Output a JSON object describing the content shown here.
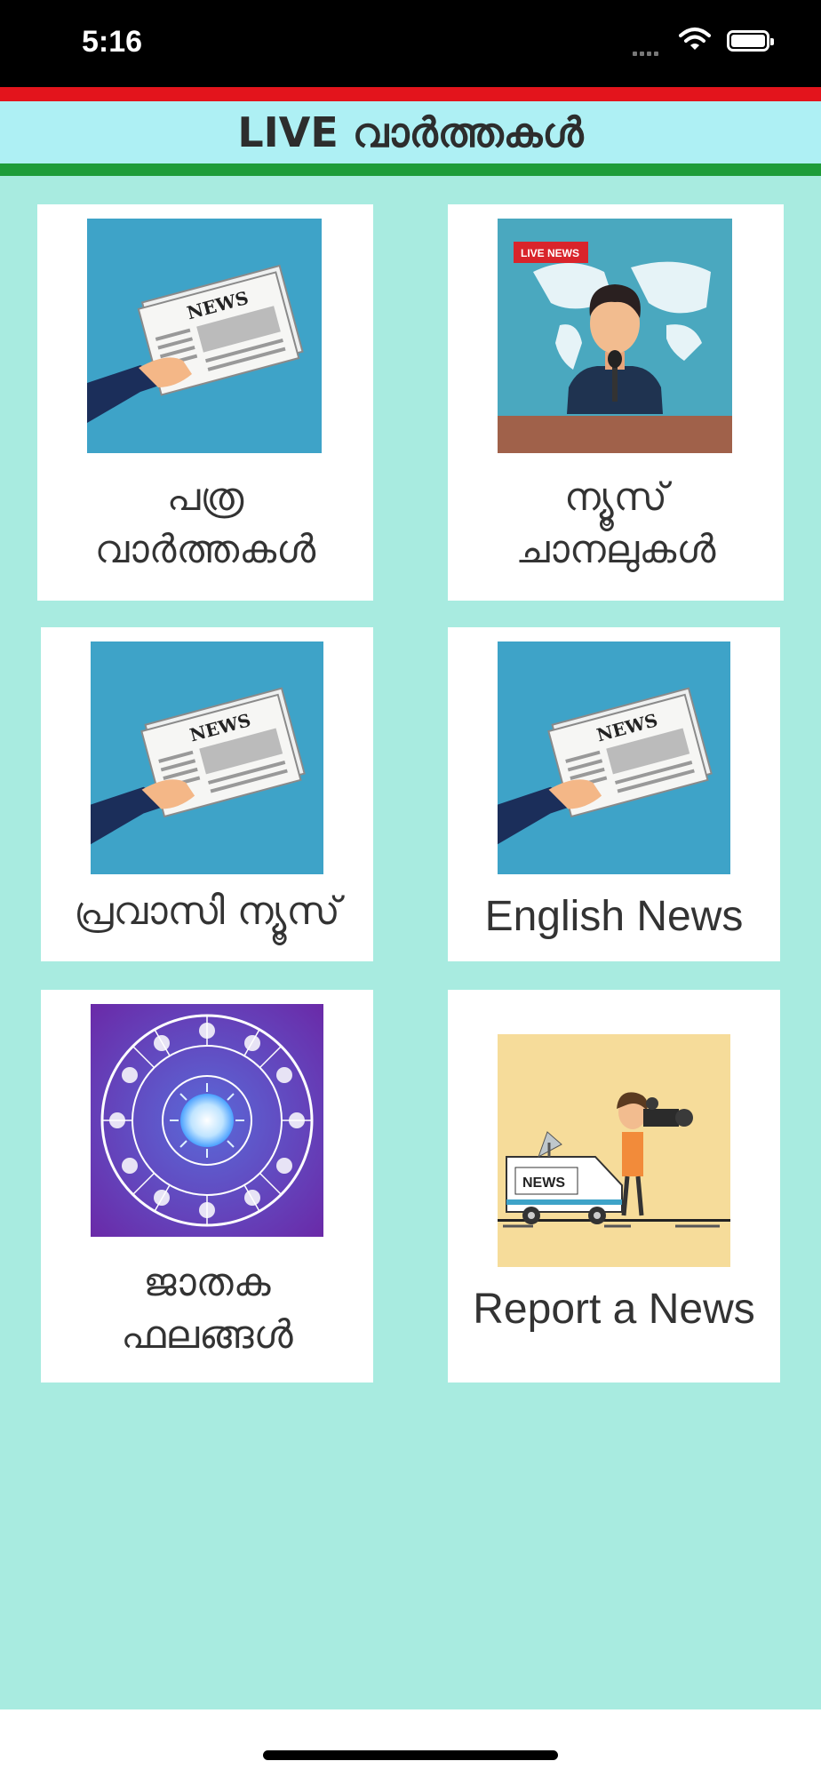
{
  "status_bar": {
    "time": "5:16"
  },
  "header": {
    "title": "LIVE വാർത്തകൾ"
  },
  "colors": {
    "background": "#a8ebe0",
    "header_red": "#e3141c",
    "header_bg": "#aef0f4",
    "header_green": "#1e9c3a",
    "card_bg": "#ffffff",
    "news_icon_bg": "#3ea3c8",
    "report_icon_bg": "#f6dc9a"
  },
  "cards": [
    {
      "line1": "പത്ര",
      "line2": "വാർത്തകൾ",
      "icon": "newspaper-icon",
      "badge": "NEWS"
    },
    {
      "line1": "ന്യൂസ്",
      "line2": "ചാനലുകൾ",
      "icon": "news-anchor-icon",
      "badge": "LIVE NEWS"
    },
    {
      "line1": "പ്രവാസി ന്യൂസ്",
      "icon": "newspaper-icon",
      "badge": "NEWS"
    },
    {
      "line1": "English News",
      "icon": "newspaper-icon",
      "badge": "NEWS"
    },
    {
      "line1": "ജാതക",
      "line2": "ഫലങ്ങൾ",
      "icon": "zodiac-wheel-icon"
    },
    {
      "line1": "Report a News",
      "icon": "news-reporter-icon",
      "badge": "NEWS"
    }
  ]
}
